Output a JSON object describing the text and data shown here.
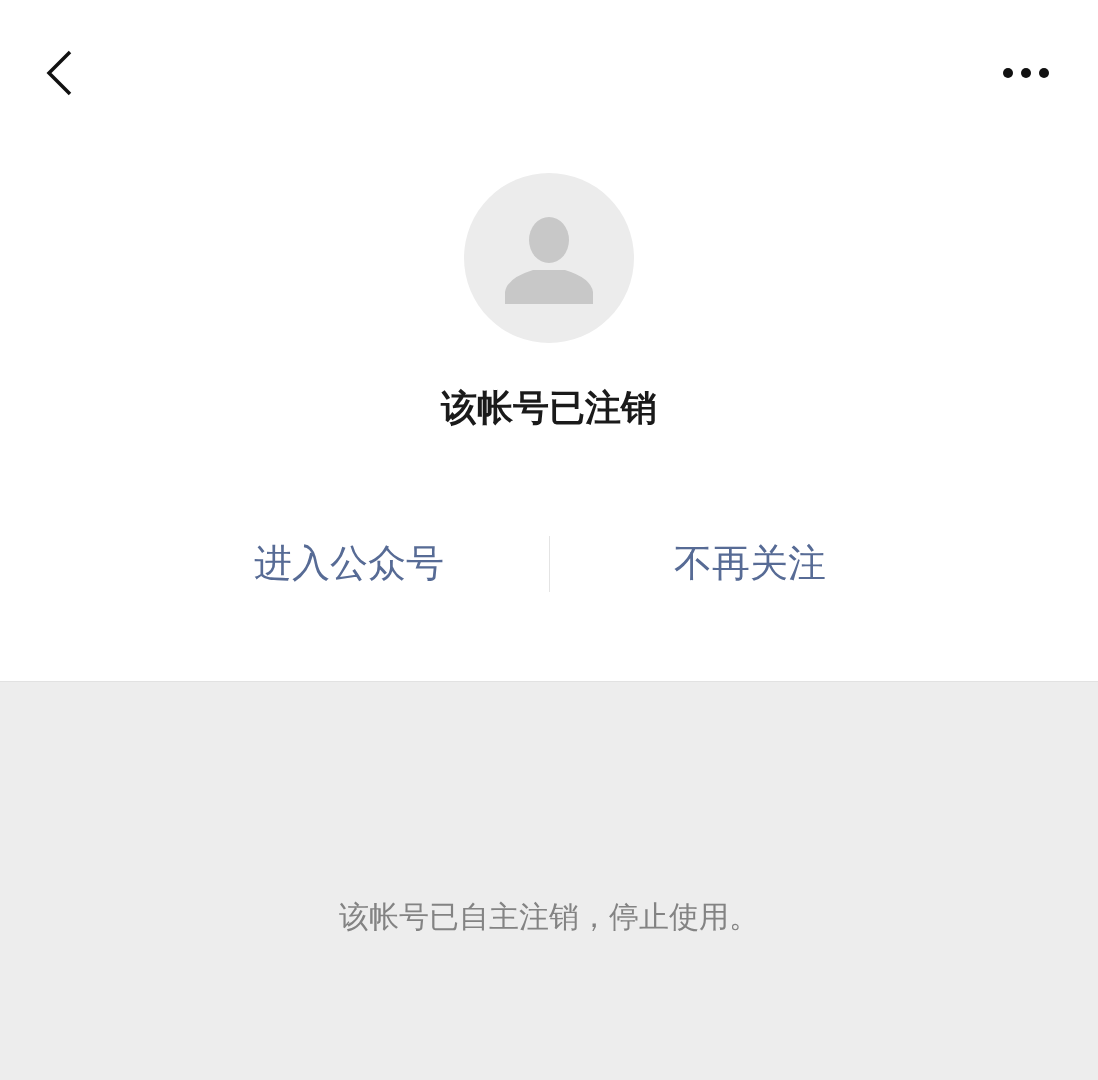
{
  "account": {
    "name": "该帐号已注销"
  },
  "actions": [
    {
      "label": "进入公众号"
    },
    {
      "label": "不再关注"
    }
  ],
  "notice": "该帐号已自主注销，停止使用。"
}
